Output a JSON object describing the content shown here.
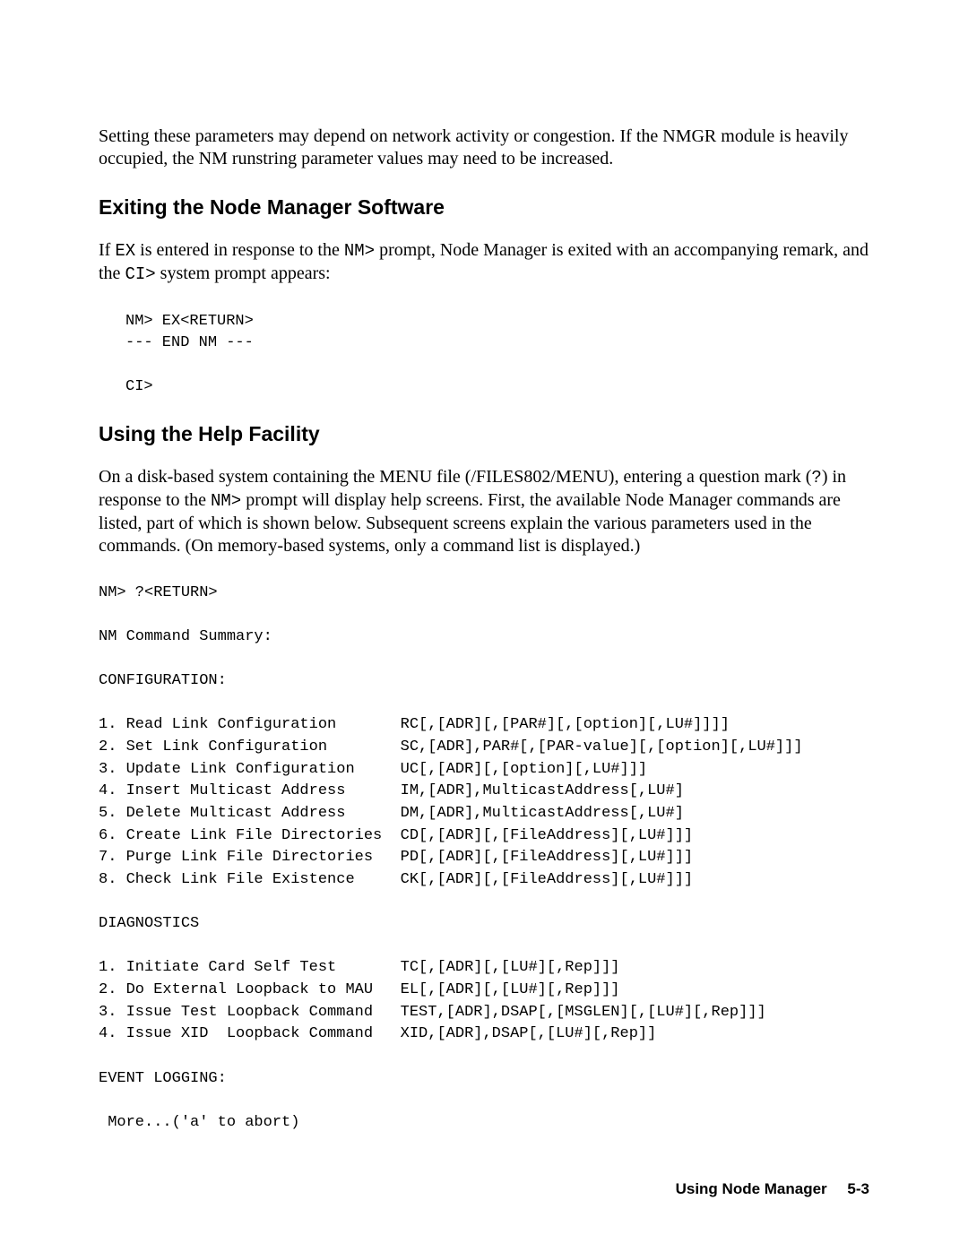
{
  "intro_paragraph": "Setting these parameters may depend on network activity or congestion.  If the NMGR module is heavily occupied, the NM runstring parameter values may need to be increased.",
  "section1_heading": "Exiting the Node Manager Software",
  "section1_p_a": "If ",
  "section1_code_ex": "EX",
  "section1_p_b": " is entered in response to the ",
  "section1_code_nm": "NM>",
  "section1_p_c": " prompt, Node Manager is exited with an accompanying remark, and the ",
  "section1_code_ci": "CI>",
  "section1_p_d": " system prompt appears:",
  "code_block_1": "NM> EX<RETURN>\n--- END NM ---\n\nCI>",
  "section2_heading": "Using the Help Facility",
  "section2_p_a": "On a disk-based system containing the MENU file (/FILES802/MENU), entering a question mark (",
  "section2_code_q": "?",
  "section2_p_b": ") in response to the ",
  "section2_code_nm": "NM>",
  "section2_p_c": " prompt will display help screens.  First, the available Node Manager commands are listed, part of which is shown below.  Subsequent screens explain the various parameters used in the commands.  (On memory-based systems, only a command list is displayed.)",
  "code_block_2": "NM> ?<RETURN>\n\nNM Command Summary:\n\nCONFIGURATION:\n\n1. Read Link Configuration       RC[,[ADR][,[PAR#][,[option][,LU#]]]]\n2. Set Link Configuration        SC,[ADR],PAR#[,[PAR-value][,[option][,LU#]]]\n3. Update Link Configuration     UC[,[ADR][,[option][,LU#]]]\n4. Insert Multicast Address      IM,[ADR],MulticastAddress[,LU#]\n5. Delete Multicast Address      DM,[ADR],MulticastAddress[,LU#]\n6. Create Link File Directories  CD[,[ADR][,[FileAddress][,LU#]]]\n7. Purge Link File Directories   PD[,[ADR][,[FileAddress][,LU#]]]\n8. Check Link File Existence     CK[,[ADR][,[FileAddress][,LU#]]]\n\nDIAGNOSTICS\n\n1. Initiate Card Self Test       TC[,[ADR][,[LU#][,Rep]]]\n2. Do External Loopback to MAU   EL[,[ADR][,[LU#][,Rep]]]\n3. Issue Test Loopback Command   TEST,[ADR],DSAP[,[MSGLEN][,[LU#][,Rep]]]\n4. Issue XID  Loopback Command   XID,[ADR],DSAP[,[LU#][,Rep]]\n\nEVENT LOGGING:\n\n More...('a' to abort)",
  "footer_title": "Using Node Manager",
  "footer_page": "5-3"
}
